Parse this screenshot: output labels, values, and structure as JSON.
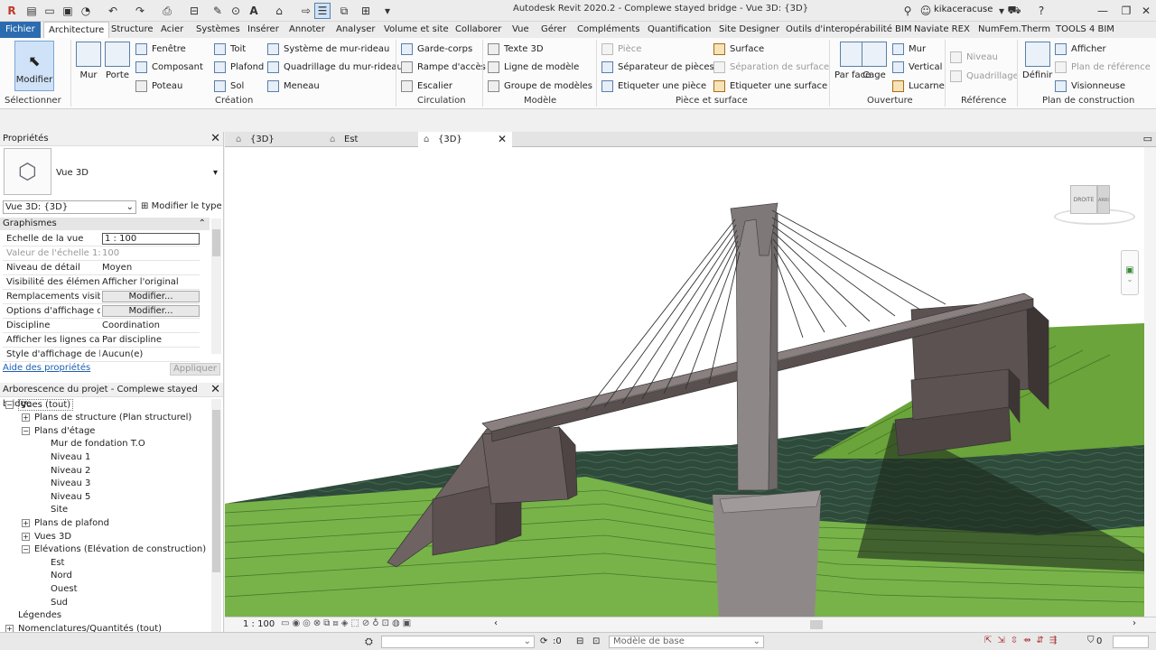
{
  "window": {
    "title": "Autodesk Revit 2020.2 - Complewe stayed bridge - Vue 3D: {3D}",
    "user": "kikaceracuse"
  },
  "ribbon_tabs": [
    "Fichier",
    "Architecture",
    "Structure",
    "Acier",
    "Systèmes",
    "Insérer",
    "Annoter",
    "Analyser",
    "Volume et site",
    "Collaborer",
    "Vue",
    "Gérer",
    "Compléments",
    "Quantification",
    "Site Designer",
    "Outils d'interopérabilité BIM",
    "Naviate REX",
    "NumFem.Therm",
    "TOOLS 4 BIM"
  ],
  "ribbon": {
    "select": {
      "modifier": "Modifier",
      "panel": "Sélectionner"
    },
    "creation": {
      "mur": "Mur",
      "porte": "Porte",
      "fenetre": "Fenêtre",
      "composant": "Composant",
      "poteau": "Poteau",
      "toit": "Toit",
      "plafond": "Plafond",
      "sol": "Sol",
      "mur_rideau": "Système de mur-rideau",
      "quadrillage": "Quadrillage du mur-rideau",
      "meneau": "Meneau",
      "panel": "Création"
    },
    "circulation": {
      "garde_corps": "Garde-corps",
      "rampe": "Rampe d'accès",
      "escalier": "Escalier",
      "panel": "Circulation"
    },
    "modele": {
      "texte3d": "Texte 3D",
      "ligne": "Ligne de modèle",
      "groupe": "Groupe de modèles",
      "panel": "Modèle"
    },
    "piece": {
      "piece": "Pièce",
      "separateur": "Séparateur de pièces",
      "etiq_piece": "Etiqueter une pièce",
      "surface": "Surface",
      "sep_surface": "Séparation de surface",
      "etiq_surface": "Etiqueter une surface",
      "panel": "Pièce et surface"
    },
    "ouverture": {
      "par_face": "Par face",
      "cage": "Cage",
      "mur": "Mur",
      "vertical": "Vertical",
      "lucarne": "Lucarne",
      "panel": "Ouverture"
    },
    "reference": {
      "niveau": "Niveau",
      "quadrillage": "Quadrillage",
      "panel": "Référence"
    },
    "plan": {
      "definir": "Définir",
      "afficher": "Afficher",
      "plan_ref": "Plan de référence",
      "visionneuse": "Visionneuse",
      "panel": "Plan de construction"
    }
  },
  "properties": {
    "title": "Propriétés",
    "type_name": "Vue 3D",
    "selector": "Vue 3D: {3D}",
    "edit_type": "Modifier le type",
    "section": "Graphismes",
    "rows": [
      {
        "k": "Echelle de la vue",
        "v": "1 : 100"
      },
      {
        "k": "Valeur de l'échelle    1:",
        "v": "100"
      },
      {
        "k": "Niveau de détail",
        "v": "Moyen"
      },
      {
        "k": "Visibilité des éléments",
        "v": "Afficher l'original"
      },
      {
        "k": "Remplacements visibi...",
        "v": "Modifier..."
      },
      {
        "k": "Options d'affichage d...",
        "v": "Modifier..."
      },
      {
        "k": "Discipline",
        "v": "Coordination"
      },
      {
        "k": "Afficher les lignes cac...",
        "v": "Par discipline"
      },
      {
        "k": "Style d'affichage de l'...",
        "v": "Aucun(e)"
      }
    ],
    "help": "Aide des propriétés",
    "apply": "Appliquer"
  },
  "browser": {
    "title": "Arborescence du projet - Complewe stayed bridge",
    "nodes": [
      {
        "label": "Vues (tout)",
        "level": 0,
        "toggle": "−"
      },
      {
        "label": "Plans de structure (Plan structurel)",
        "level": 1,
        "toggle": "+"
      },
      {
        "label": "Plans d'étage",
        "level": 1,
        "toggle": "−"
      },
      {
        "label": "Mur de fondation T.O",
        "level": 2,
        "toggle": ""
      },
      {
        "label": "Niveau 1",
        "level": 2,
        "toggle": ""
      },
      {
        "label": "Niveau 2",
        "level": 2,
        "toggle": ""
      },
      {
        "label": "Niveau 3",
        "level": 2,
        "toggle": ""
      },
      {
        "label": "Niveau 5",
        "level": 2,
        "toggle": ""
      },
      {
        "label": "Site",
        "level": 2,
        "toggle": ""
      },
      {
        "label": "Plans de plafond",
        "level": 1,
        "toggle": "+"
      },
      {
        "label": "Vues 3D",
        "level": 1,
        "toggle": "+"
      },
      {
        "label": "Elévations (Elévation de construction)",
        "level": 1,
        "toggle": "−"
      },
      {
        "label": "Est",
        "level": 2,
        "toggle": ""
      },
      {
        "label": "Nord",
        "level": 2,
        "toggle": ""
      },
      {
        "label": "Ouest",
        "level": 2,
        "toggle": ""
      },
      {
        "label": "Sud",
        "level": 2,
        "toggle": ""
      },
      {
        "label": "Légendes",
        "level": 0,
        "toggle": ""
      },
      {
        "label": "Nomenclatures/Quantités (tout)",
        "level": 0,
        "toggle": "+"
      }
    ]
  },
  "view_tabs": [
    "{3D}",
    "Est",
    "{3D}"
  ],
  "viewcube": {
    "right": "DROITE",
    "back": "ARRIÈRE"
  },
  "view_scale": "1 : 100",
  "statusbar": {
    "zero": ":0",
    "model": "Modèle de base",
    "filter": "0"
  }
}
